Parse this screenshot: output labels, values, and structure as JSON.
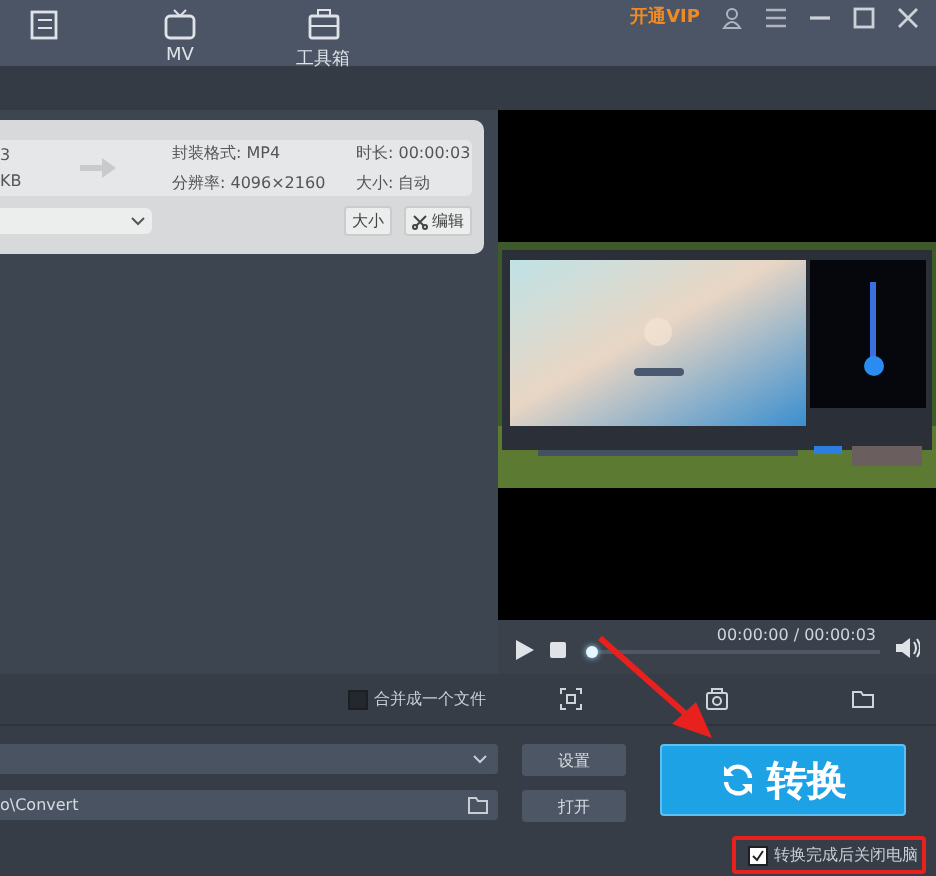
{
  "title_bar": {
    "tabs": [
      {
        "selected": false
      },
      {
        "label": "MV",
        "selected": false
      },
      {
        "label": "工具箱",
        "selected": false
      }
    ],
    "vip_link": "开通VIP"
  },
  "file_card": {
    "source_name": "3",
    "source_size": "KB",
    "format": "封装格式: MP4",
    "resolution": "分辨率: 4096×2160",
    "duration": "时长: 00:00:03",
    "size": "大小: 自动",
    "size_button": "大小",
    "edit_button": "编辑"
  },
  "player": {
    "time": "00:00:00 / 00:00:03",
    "level": 0.0
  },
  "merge_option": {
    "label": "合并成一个文件",
    "checked": false
  },
  "output": {
    "save_path": "o\\Convert",
    "settings_button": "设置",
    "open_button": "打开",
    "convert_button": "转换"
  },
  "shutdown_option": {
    "label": "转换完成后关闭电脑",
    "checked": true
  }
}
